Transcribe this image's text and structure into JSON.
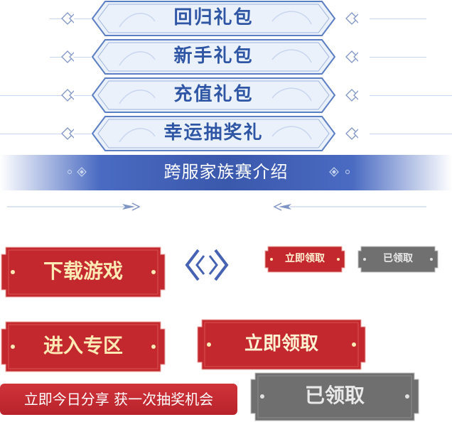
{
  "menu": {
    "items": [
      {
        "label": "回归礼包"
      },
      {
        "label": "新手礼包"
      },
      {
        "label": "充值礼包"
      },
      {
        "label": "幸运抽奖礼"
      }
    ]
  },
  "banner": {
    "title": "跨服家族赛介绍"
  },
  "buttons": {
    "download": "下载游戏",
    "claim_small": "立即领取",
    "claimed_small": "已领取",
    "enter_zone": "进入专区",
    "claim_large": "立即领取",
    "claimed_large": "已领取",
    "share": "立即今日分享  获一次抽奖机会"
  },
  "colors": {
    "menu_text": "#2f56a5",
    "menu_fill": "#eaf1fb",
    "menu_border": "#5c7fc4",
    "banner": "#3a58ac",
    "red": "#c4282f",
    "red_text": "#fde9b4",
    "grey": "#6f6f6f"
  },
  "icons": [
    "diamond-ornament-icon",
    "arrow-left-icon",
    "arrow-right-icon",
    "chevron-left-icon",
    "chevron-right-icon"
  ]
}
